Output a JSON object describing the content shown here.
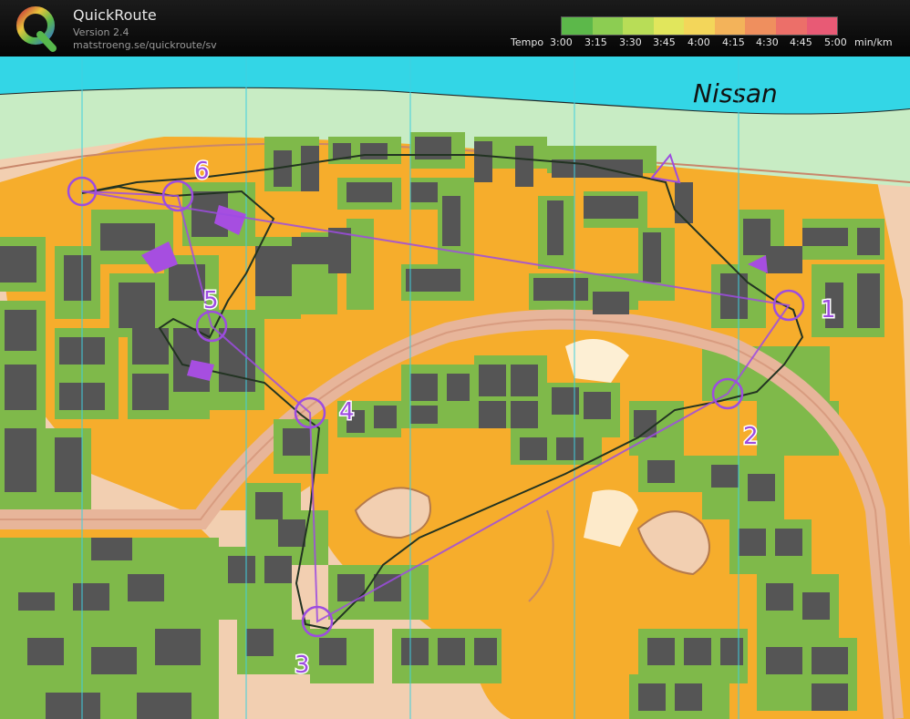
{
  "app": {
    "title": "QuickRoute",
    "version": "Version 2.4",
    "url": "matstroeng.se/quickroute/sv"
  },
  "legend": {
    "label": "Tempo",
    "ticks": [
      "3:00",
      "3:15",
      "3:30",
      "3:45",
      "4:00",
      "4:15",
      "4:30",
      "4:45",
      "5:00"
    ],
    "unit": "min/km",
    "colors": [
      "#5cb84a",
      "#8ccd52",
      "#b8dd57",
      "#e1e65c",
      "#f3d65a",
      "#f3b35a",
      "#ef8f5e",
      "#ec6f69",
      "#e85a75"
    ]
  },
  "map": {
    "place_label": "Nissan",
    "controls": [
      {
        "label": "1"
      },
      {
        "label": "2"
      },
      {
        "label": "3"
      },
      {
        "label": "4"
      },
      {
        "label": "5"
      },
      {
        "label": "6"
      }
    ],
    "colors": {
      "open_land": "#f6ad2c",
      "green_land": "#7fb94a",
      "water": "#33d6e6",
      "building": "#555555",
      "paved": "#f2cfb1",
      "road": "#e7b59a",
      "course": "#9d4ce0"
    }
  }
}
